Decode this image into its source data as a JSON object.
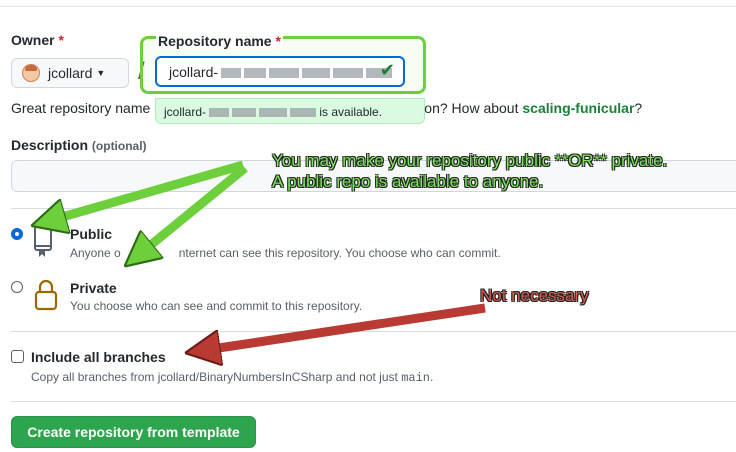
{
  "owner": {
    "label": "Owner",
    "required_mark": "*",
    "username": "jcollard"
  },
  "repository": {
    "label": "Repository name",
    "required_mark": "*",
    "value": "jcollard-",
    "availability_prefix": "jcollard-",
    "availability_suffix": "is available.",
    "valid_icon": "check-icon"
  },
  "suggestion": {
    "text_start": "Great repository name",
    "text_end": "on? How about",
    "name": "scaling-funicular",
    "question_mark": "?"
  },
  "description": {
    "label": "Description",
    "optional": "(optional)"
  },
  "visibility": {
    "public": {
      "title": "Public",
      "desc_part1": "Anyone o",
      "desc_part2": "nternet can see this repository. You choose who can commit.",
      "selected": true,
      "icon": "repo-icon"
    },
    "private": {
      "title": "Private",
      "desc": "You choose who can see and commit to this repository.",
      "selected": false,
      "icon": "lock-icon"
    }
  },
  "branches": {
    "title": "Include all branches",
    "desc_prefix": "Copy all branches from jcollard/BinaryNumbersInCSharp and not just",
    "branch": "main",
    "desc_suffix": ".",
    "checked": false
  },
  "create_button": "Create repository from template",
  "annotations": {
    "green_note": "You may make your repository public **OR** private. A public repo is available to anyone.",
    "red_note": "Not necessary"
  },
  "colors": {
    "primary_blue": "#0969da",
    "green_button": "#2da44e",
    "suggest_green": "#1a7f37",
    "annot_green": "#7be45a",
    "annot_red": "#b83a32"
  }
}
